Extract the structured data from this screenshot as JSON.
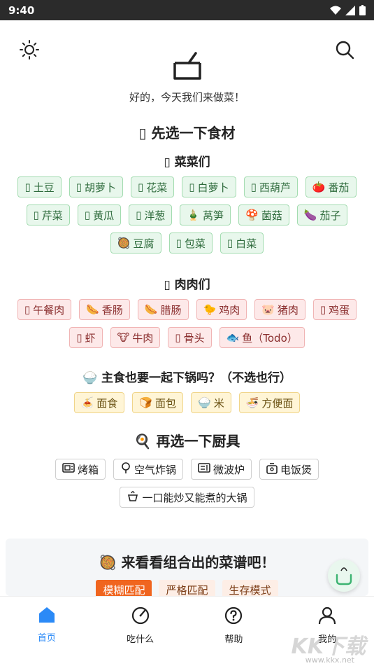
{
  "status": {
    "time": "9:40"
  },
  "header": {
    "tagline": "好的，今天我们来做菜！"
  },
  "ingredients": {
    "title_icon": "▯",
    "title": "先选一下食材",
    "veg_icon": "▯",
    "veg_title": "菜菜们",
    "veg": [
      {
        "emoji": "▯",
        "label": "土豆"
      },
      {
        "emoji": "▯",
        "label": "胡萝卜"
      },
      {
        "emoji": "▯",
        "label": "花菜"
      },
      {
        "emoji": "▯",
        "label": "白萝卜"
      },
      {
        "emoji": "▯",
        "label": "西葫芦"
      },
      {
        "emoji": "🍅",
        "label": "番茄"
      },
      {
        "emoji": "▯",
        "label": "芹菜"
      },
      {
        "emoji": "▯",
        "label": "黄瓜"
      },
      {
        "emoji": "▯",
        "label": "洋葱"
      },
      {
        "emoji": "🎍",
        "label": "莴笋"
      },
      {
        "emoji": "🍄",
        "label": "菌菇"
      },
      {
        "emoji": "🍆",
        "label": "茄子"
      },
      {
        "emoji": "🥘",
        "label": "豆腐"
      },
      {
        "emoji": "▯",
        "label": "包菜"
      },
      {
        "emoji": "▯",
        "label": "白菜"
      }
    ],
    "meat_icon": "▯",
    "meat_title": "肉肉们",
    "meat": [
      {
        "emoji": "▯",
        "label": "午餐肉"
      },
      {
        "emoji": "🌭",
        "label": "香肠"
      },
      {
        "emoji": "🌭",
        "label": "腊肠"
      },
      {
        "emoji": "🐤",
        "label": "鸡肉"
      },
      {
        "emoji": "🐷",
        "label": "猪肉"
      },
      {
        "emoji": "▯",
        "label": "鸡蛋"
      },
      {
        "emoji": "▯",
        "label": "虾"
      },
      {
        "emoji": "🐮",
        "label": "牛肉"
      },
      {
        "emoji": "▯",
        "label": "骨头"
      },
      {
        "emoji": "🐟",
        "label": "鱼（Todo）"
      }
    ],
    "staple_emoji": "🍚",
    "staple_title": "主食也要一起下锅吗？（不选也行）",
    "staple": [
      {
        "emoji": "🍝",
        "label": "面食"
      },
      {
        "emoji": "🍞",
        "label": "面包"
      },
      {
        "emoji": "🍚",
        "label": "米"
      },
      {
        "emoji": "🍜",
        "label": "方便面"
      }
    ]
  },
  "tools": {
    "title_emoji": "🍳",
    "title": "再选一下厨具",
    "items": [
      {
        "icon": "oven-icon",
        "label": "烤箱"
      },
      {
        "icon": "air-fryer-icon",
        "label": "空气炸锅"
      },
      {
        "icon": "microwave-icon",
        "label": "微波炉"
      },
      {
        "icon": "rice-cooker-icon",
        "label": "电饭煲"
      },
      {
        "icon": "wok-icon",
        "label": "一口能炒又能煮的大锅"
      }
    ]
  },
  "result": {
    "emoji": "🥘",
    "title": "来看看组合出的菜谱吧！",
    "modes": [
      "模糊匹配",
      "严格匹配",
      "生存模式"
    ],
    "active_mode": 0
  },
  "nav": {
    "items": [
      {
        "icon": "home-icon",
        "label": "首页"
      },
      {
        "icon": "dice-icon",
        "label": "吃什么"
      },
      {
        "icon": "help-icon",
        "label": "帮助"
      },
      {
        "icon": "user-icon",
        "label": "我的"
      }
    ],
    "active": 0
  },
  "watermark": {
    "text": "KK下载",
    "url": "www.kkx.net"
  },
  "colors": {
    "accent": "#f0651f",
    "nav_active": "#2b8af7",
    "veg_bg": "#e8f7ec",
    "meat_bg": "#fde9e9",
    "staple_bg": "#fff5d6"
  }
}
